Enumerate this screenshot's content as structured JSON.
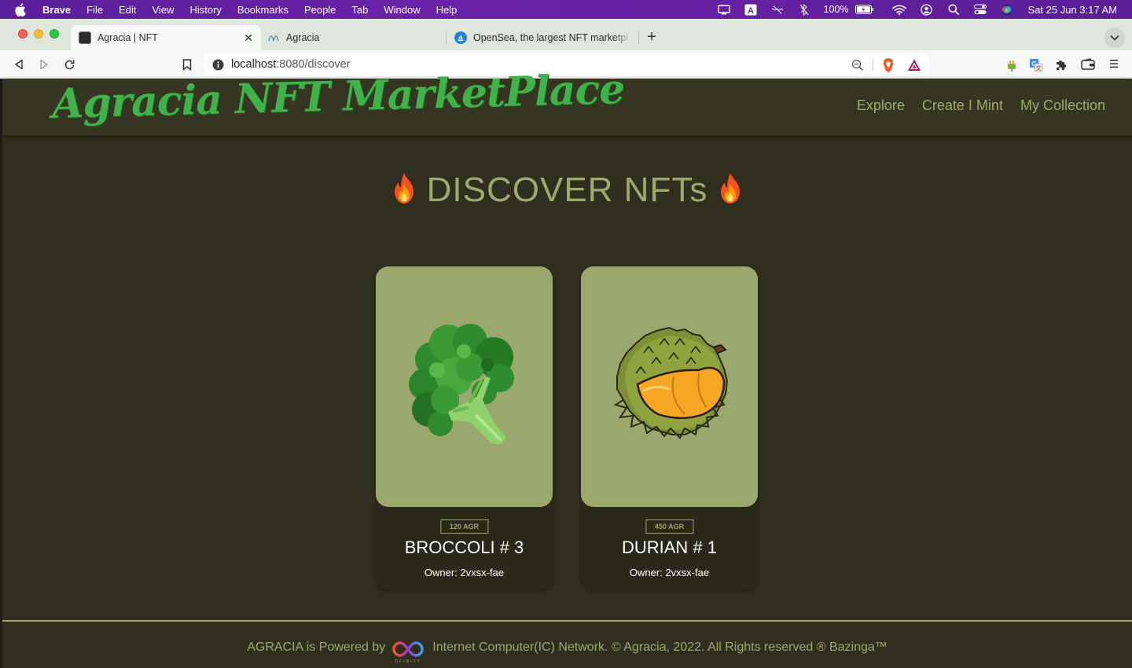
{
  "menubar": {
    "app_name": "Brave",
    "items": [
      "File",
      "Edit",
      "View",
      "History",
      "Bookmarks",
      "People",
      "Tab",
      "Window",
      "Help"
    ],
    "battery": "100%",
    "clock": "Sat 25 Jun  3:17 AM"
  },
  "browser": {
    "tabs": [
      {
        "label": "Agracia | NFT",
        "active": true
      },
      {
        "label": "Agracia",
        "active": false
      },
      {
        "label": "OpenSea, the largest NFT marketpl",
        "active": false
      }
    ],
    "url_host": "localhost",
    "url_rest": ":8080/discover"
  },
  "site": {
    "logo": "Agracia NFT MarketPlace",
    "nav": [
      "Explore",
      "Create I Mint",
      "My Collection"
    ],
    "page_title": "DISCOVER NFTs",
    "colors": {
      "accent": "#9caa6e",
      "logo": "#3fb24a",
      "background": "#2f2e1f",
      "card_image_bg": "#9aa86d"
    }
  },
  "cards": [
    {
      "price": "120 AGR",
      "name": "BROCCOLI # 3",
      "owner": "Owner: 2vxsx-fae",
      "image": "broccoli"
    },
    {
      "price": "450 AGR",
      "name": "DURIAN # 1",
      "owner": "Owner: 2vxsx-fae",
      "image": "durian"
    }
  ],
  "footer": {
    "before": "AGRACIA is Powered by",
    "logo_text": "DFINITY",
    "after": "Internet Computer(IC) Network. © Agracia, 2022. All Rights reserved ® Bazinga™"
  }
}
